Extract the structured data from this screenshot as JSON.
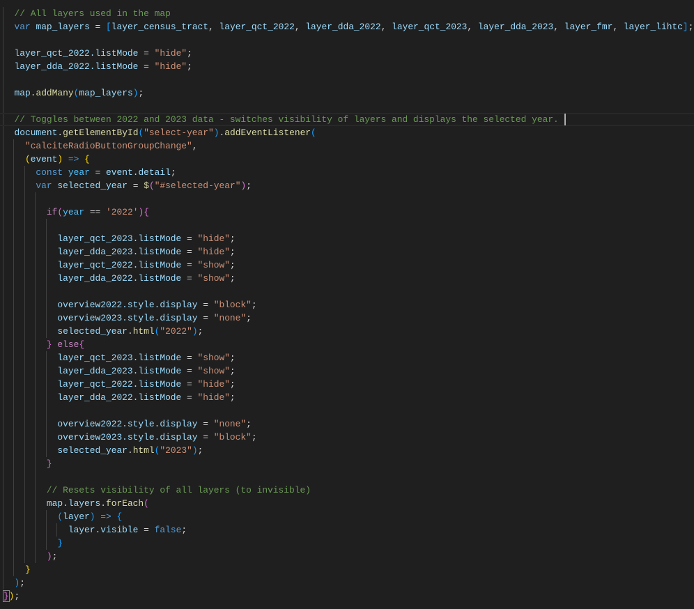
{
  "editor": {
    "colors": {
      "background": "#1f1f1f",
      "comment": "#6a9955",
      "keyword": "#569cd6",
      "variable": "#9cdcfe",
      "string": "#ce9178",
      "function": "#dcdcaa"
    },
    "current_line": 8,
    "lines": [
      {
        "indent": 2,
        "tokens": [
          [
            "c",
            "// All layers used in the map"
          ]
        ]
      },
      {
        "indent": 2,
        "tokens": [
          [
            "k",
            "var"
          ],
          [
            "o",
            " "
          ],
          [
            "v",
            "map_layers"
          ],
          [
            "o",
            " = "
          ],
          [
            "b3",
            "["
          ],
          [
            "v",
            "layer_census_tract"
          ],
          [
            "o",
            ", "
          ],
          [
            "v",
            "layer_qct_2022"
          ],
          [
            "o",
            ", "
          ],
          [
            "v",
            "layer_dda_2022"
          ],
          [
            "o",
            ", "
          ],
          [
            "v",
            "layer_qct_2023"
          ],
          [
            "o",
            ", "
          ],
          [
            "v",
            "layer_dda_2023"
          ],
          [
            "o",
            ", "
          ],
          [
            "v",
            "layer_fmr"
          ],
          [
            "o",
            ", "
          ],
          [
            "v",
            "layer_lihtc"
          ],
          [
            "b3",
            "]"
          ],
          [
            "o",
            ";"
          ]
        ]
      },
      {
        "indent": 0,
        "tokens": []
      },
      {
        "indent": 2,
        "tokens": [
          [
            "v",
            "layer_qct_2022.listMode"
          ],
          [
            "o",
            " = "
          ],
          [
            "s",
            "\"hide\""
          ],
          [
            "o",
            ";"
          ]
        ]
      },
      {
        "indent": 2,
        "tokens": [
          [
            "v",
            "layer_dda_2022.listMode"
          ],
          [
            "o",
            " = "
          ],
          [
            "s",
            "\"hide\""
          ],
          [
            "o",
            ";"
          ]
        ]
      },
      {
        "indent": 0,
        "tokens": []
      },
      {
        "indent": 2,
        "tokens": [
          [
            "v",
            "map"
          ],
          [
            "o",
            "."
          ],
          [
            "f",
            "addMany"
          ],
          [
            "b3",
            "("
          ],
          [
            "v",
            "map_layers"
          ],
          [
            "b3",
            ")"
          ],
          [
            "o",
            ";"
          ]
        ]
      },
      {
        "indent": 0,
        "tokens": []
      },
      {
        "indent": 2,
        "tokens": [
          [
            "c",
            "// Toggles between 2022 and 2023 data - switches visibility of layers and displays the selected year. "
          ]
        ]
      },
      {
        "indent": 2,
        "tokens": [
          [
            "v",
            "document"
          ],
          [
            "o",
            "."
          ],
          [
            "f",
            "getElementById"
          ],
          [
            "b3",
            "("
          ],
          [
            "s",
            "\"select-year\""
          ],
          [
            "b3",
            ")"
          ],
          [
            "o",
            "."
          ],
          [
            "f",
            "addEventListener"
          ],
          [
            "b3",
            "("
          ]
        ]
      },
      {
        "indent": 4,
        "tokens": [
          [
            "s",
            "\"calciteRadioButtonGroupChange\""
          ],
          [
            "o",
            ","
          ]
        ]
      },
      {
        "indent": 4,
        "tokens": [
          [
            "b1",
            "("
          ],
          [
            "v",
            "event"
          ],
          [
            "b1",
            ")"
          ],
          [
            "o",
            " "
          ],
          [
            "k",
            "=>"
          ],
          [
            "o",
            " "
          ],
          [
            "b1",
            "{"
          ]
        ]
      },
      {
        "indent": 6,
        "tokens": [
          [
            "k",
            "const"
          ],
          [
            "o",
            " "
          ],
          [
            "cn",
            "year"
          ],
          [
            "o",
            " = "
          ],
          [
            "v",
            "event.detail"
          ],
          [
            "o",
            ";"
          ]
        ]
      },
      {
        "indent": 6,
        "tokens": [
          [
            "k",
            "var"
          ],
          [
            "o",
            " "
          ],
          [
            "v",
            "selected_year"
          ],
          [
            "o",
            " = "
          ],
          [
            "f",
            "$"
          ],
          [
            "b2",
            "("
          ],
          [
            "s",
            "\"#selected-year\""
          ],
          [
            "b2",
            ")"
          ],
          [
            "o",
            ";"
          ]
        ]
      },
      {
        "indent": 0,
        "tokens": []
      },
      {
        "indent": 8,
        "tokens": [
          [
            "x",
            "if"
          ],
          [
            "b2",
            "("
          ],
          [
            "cn",
            "year"
          ],
          [
            "o",
            " == "
          ],
          [
            "s",
            "'2022'"
          ],
          [
            "b2",
            ")"
          ],
          [
            "b2",
            "{"
          ]
        ]
      },
      {
        "indent": 0,
        "tokens": []
      },
      {
        "indent": 10,
        "tokens": [
          [
            "v",
            "layer_qct_2023.listMode"
          ],
          [
            "o",
            " = "
          ],
          [
            "s",
            "\"hide\""
          ],
          [
            "o",
            ";"
          ]
        ]
      },
      {
        "indent": 10,
        "tokens": [
          [
            "v",
            "layer_dda_2023.listMode"
          ],
          [
            "o",
            " = "
          ],
          [
            "s",
            "\"hide\""
          ],
          [
            "o",
            ";"
          ]
        ]
      },
      {
        "indent": 10,
        "tokens": [
          [
            "v",
            "layer_qct_2022.listMode"
          ],
          [
            "o",
            " = "
          ],
          [
            "s",
            "\"show\""
          ],
          [
            "o",
            ";"
          ]
        ]
      },
      {
        "indent": 10,
        "tokens": [
          [
            "v",
            "layer_dda_2022.listMode"
          ],
          [
            "o",
            " = "
          ],
          [
            "s",
            "\"show\""
          ],
          [
            "o",
            ";"
          ]
        ]
      },
      {
        "indent": 0,
        "tokens": []
      },
      {
        "indent": 10,
        "tokens": [
          [
            "v",
            "overview2022.style.display"
          ],
          [
            "o",
            " = "
          ],
          [
            "s",
            "\"block\""
          ],
          [
            "o",
            ";"
          ]
        ]
      },
      {
        "indent": 10,
        "tokens": [
          [
            "v",
            "overview2023.style.display"
          ],
          [
            "o",
            " = "
          ],
          [
            "s",
            "\"none\""
          ],
          [
            "o",
            ";"
          ]
        ]
      },
      {
        "indent": 10,
        "tokens": [
          [
            "v",
            "selected_year"
          ],
          [
            "o",
            "."
          ],
          [
            "f",
            "html"
          ],
          [
            "b3",
            "("
          ],
          [
            "s",
            "\"2022\""
          ],
          [
            "b3",
            ")"
          ],
          [
            "o",
            ";"
          ]
        ]
      },
      {
        "indent": 8,
        "tokens": [
          [
            "b2",
            "}"
          ],
          [
            "o",
            " "
          ],
          [
            "x",
            "else"
          ],
          [
            "b2",
            "{"
          ]
        ]
      },
      {
        "indent": 10,
        "tokens": [
          [
            "v",
            "layer_qct_2023.listMode"
          ],
          [
            "o",
            " = "
          ],
          [
            "s",
            "\"show\""
          ],
          [
            "o",
            ";"
          ]
        ]
      },
      {
        "indent": 10,
        "tokens": [
          [
            "v",
            "layer_dda_2023.listMode"
          ],
          [
            "o",
            " = "
          ],
          [
            "s",
            "\"show\""
          ],
          [
            "o",
            ";"
          ]
        ]
      },
      {
        "indent": 10,
        "tokens": [
          [
            "v",
            "layer_qct_2022.listMode"
          ],
          [
            "o",
            " = "
          ],
          [
            "s",
            "\"hide\""
          ],
          [
            "o",
            ";"
          ]
        ]
      },
      {
        "indent": 10,
        "tokens": [
          [
            "v",
            "layer_dda_2022.listMode"
          ],
          [
            "o",
            " = "
          ],
          [
            "s",
            "\"hide\""
          ],
          [
            "o",
            ";"
          ]
        ]
      },
      {
        "indent": 0,
        "tokens": []
      },
      {
        "indent": 10,
        "tokens": [
          [
            "v",
            "overview2022.style.display"
          ],
          [
            "o",
            " = "
          ],
          [
            "s",
            "\"none\""
          ],
          [
            "o",
            ";"
          ]
        ]
      },
      {
        "indent": 10,
        "tokens": [
          [
            "v",
            "overview2023.style.display"
          ],
          [
            "o",
            " = "
          ],
          [
            "s",
            "\"block\""
          ],
          [
            "o",
            ";"
          ]
        ]
      },
      {
        "indent": 10,
        "tokens": [
          [
            "v",
            "selected_year"
          ],
          [
            "o",
            "."
          ],
          [
            "f",
            "html"
          ],
          [
            "b3",
            "("
          ],
          [
            "s",
            "\"2023\""
          ],
          [
            "b3",
            ")"
          ],
          [
            "o",
            ";"
          ]
        ]
      },
      {
        "indent": 8,
        "tokens": [
          [
            "b2",
            "}"
          ]
        ]
      },
      {
        "indent": 0,
        "tokens": []
      },
      {
        "indent": 8,
        "tokens": [
          [
            "c",
            "// Resets visibility of all layers (to invisible)"
          ]
        ]
      },
      {
        "indent": 8,
        "tokens": [
          [
            "v",
            "map.layers"
          ],
          [
            "o",
            "."
          ],
          [
            "f",
            "forEach"
          ],
          [
            "b2",
            "("
          ]
        ]
      },
      {
        "indent": 10,
        "tokens": [
          [
            "b3",
            "("
          ],
          [
            "v",
            "layer"
          ],
          [
            "b3",
            ")"
          ],
          [
            "o",
            " "
          ],
          [
            "k",
            "=>"
          ],
          [
            "o",
            " "
          ],
          [
            "b3",
            "{"
          ]
        ]
      },
      {
        "indent": 12,
        "tokens": [
          [
            "v",
            "layer.visible"
          ],
          [
            "o",
            " = "
          ],
          [
            "k",
            "false"
          ],
          [
            "o",
            ";"
          ]
        ]
      },
      {
        "indent": 10,
        "tokens": [
          [
            "b3",
            "}"
          ]
        ]
      },
      {
        "indent": 8,
        "tokens": [
          [
            "b2",
            ")"
          ],
          [
            "o",
            ";"
          ]
        ]
      },
      {
        "indent": 4,
        "tokens": [
          [
            "b1",
            "}"
          ]
        ]
      },
      {
        "indent": 2,
        "tokens": [
          [
            "b3",
            ")"
          ],
          [
            "o",
            ";"
          ]
        ]
      },
      {
        "indent": 0,
        "tokens": [
          [
            "b2",
            "}"
          ],
          [
            "b1",
            ")"
          ],
          [
            "o",
            ";"
          ]
        ]
      }
    ]
  }
}
